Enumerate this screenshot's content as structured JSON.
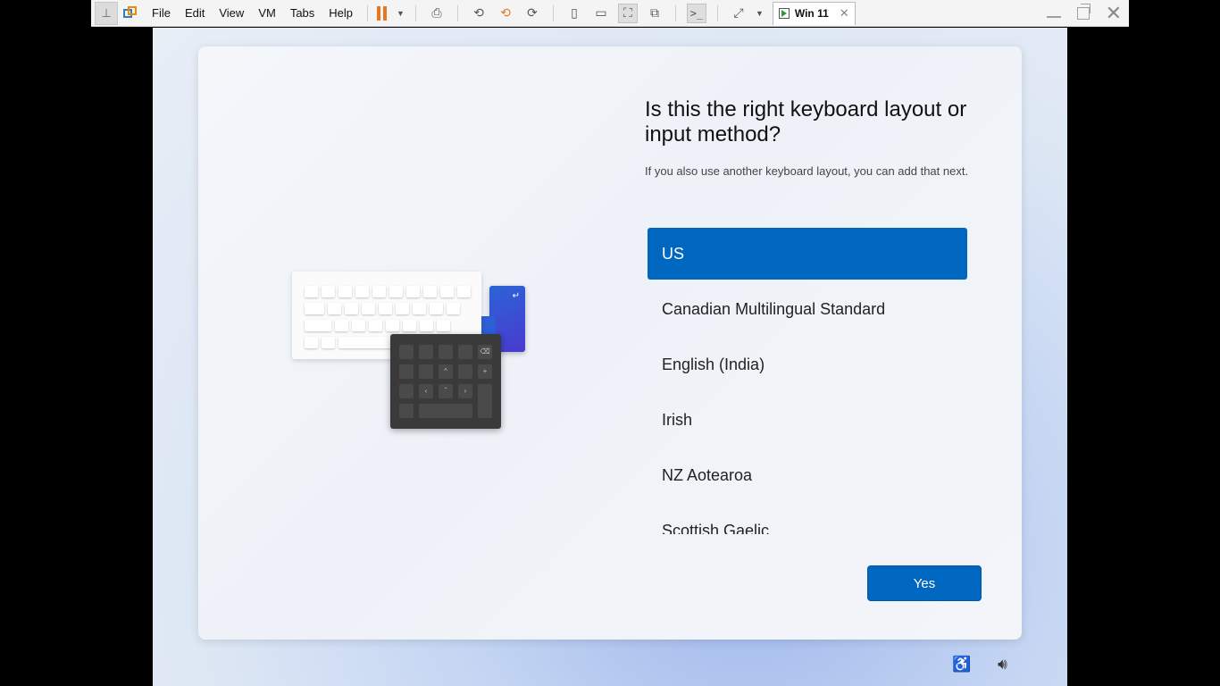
{
  "toolbar": {
    "menus": [
      "File",
      "Edit",
      "View",
      "VM",
      "Tabs",
      "Help"
    ],
    "tab_label": "Win 11"
  },
  "setup": {
    "title": "Is this the right keyboard layout or input method?",
    "subtitle": "If you also use another keyboard layout, you can add that next.",
    "layouts": [
      {
        "label": "US",
        "selected": true
      },
      {
        "label": "Canadian Multilingual Standard",
        "selected": false
      },
      {
        "label": "English (India)",
        "selected": false
      },
      {
        "label": "Irish",
        "selected": false
      },
      {
        "label": "NZ Aotearoa",
        "selected": false
      },
      {
        "label": "Scottish Gaelic",
        "selected": false
      }
    ],
    "yes_label": "Yes"
  },
  "colors": {
    "accent": "#0067c0",
    "pause": "#e87722"
  },
  "icons": [
    "pin-icon",
    "vmware-logo-icon",
    "pause-icon",
    "send-keys-icon",
    "snapshot-icon",
    "revert-icon",
    "snapshot-manager-icon",
    "console-icon",
    "fullscreen-icon",
    "accessibility-icon",
    "volume-icon"
  ]
}
